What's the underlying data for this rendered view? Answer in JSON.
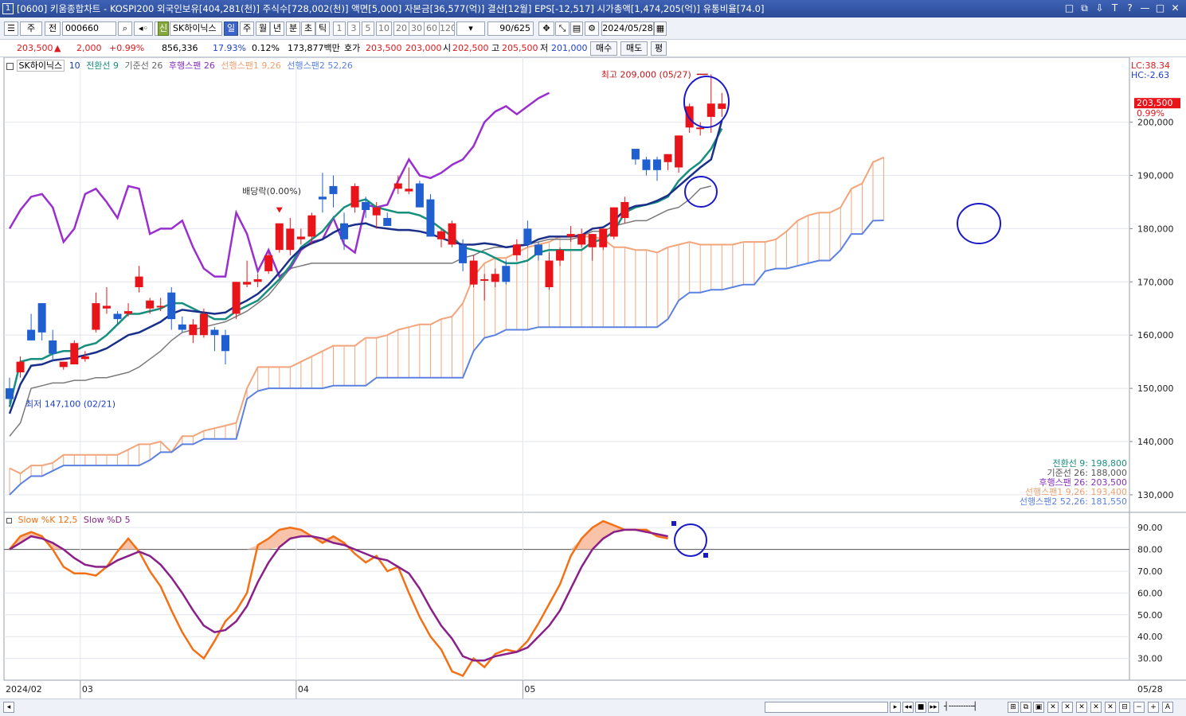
{
  "window": {
    "app_number": "1",
    "title": "[0600] 키움종합차트 - KOSPI200 외국인보유[404,281(천)] 주식수[728,002(천)] 액면[5,000] 자본금[36,577(억)] 결산[12월] EPS[-12,517] 시가총액[1,474,205(억)] 유통비율[74.0]",
    "controls": [
      "□",
      "⧉",
      "⇩",
      "T",
      "?",
      "—",
      "□",
      "✕"
    ]
  },
  "toolbar": {
    "period_select": "주",
    "all_label": "전",
    "code_input": "000660",
    "shin_badge": "신",
    "stock_name": "SK하이닉스",
    "periods": [
      "일",
      "주",
      "월",
      "년",
      "분",
      "초",
      "틱"
    ],
    "active_period": "일",
    "minute_options": [
      "1",
      "3",
      "5",
      "10",
      "20",
      "30",
      "60",
      "120"
    ],
    "count": "90/625",
    "date": "2024/05/28"
  },
  "quote": {
    "price": "203,500",
    "arrow": "▲",
    "change": "2,000",
    "change_pct": "+0.99%",
    "volume": "856,336",
    "turnover_pct": "17.93%",
    "vol_ratio": "0.12%",
    "amount": "173,877백만",
    "ask_label": "호가",
    "ask": "203,500",
    "bid": "203,000",
    "open_label": "시",
    "open": "202,500",
    "high_label": "고",
    "high": "205,500",
    "low_label": "저",
    "low": "201,000",
    "buy_btn": "매수",
    "sell_btn": "매도",
    "eval_btn": "평"
  },
  "legend_top": {
    "name": "SK하이닉스",
    "period": "10",
    "items": [
      {
        "text": "전환선 9",
        "color": "#1a8f80"
      },
      {
        "text": "기준선 26",
        "color": "#777777"
      },
      {
        "text": "후행스팬 26",
        "color": "#8a2fc0"
      },
      {
        "text": "선행스팬1 9,26",
        "color": "#f0a070"
      },
      {
        "text": "선행스팬2 52,26",
        "color": "#5b82e0"
      }
    ]
  },
  "legend_bottom": {
    "items": [
      {
        "text": "Slow %K 12,5",
        "color": "#f07010"
      },
      {
        "text": "Slow %D 5",
        "color": "#8a1f8a"
      }
    ]
  },
  "annotations": {
    "high": "최고 209,000 (05/27)",
    "low": "최저 147,100 (02/21)",
    "dividend": "배당락(0.00%)"
  },
  "right_axis": {
    "lc": "LC:38.34",
    "hc": "HC:-2.63",
    "price_tag": "203,500",
    "price_pct": "0.99%",
    "price_ticks": [
      "200,000",
      "190,000",
      "180,000",
      "170,000",
      "160,000",
      "150,000",
      "140,000",
      "130,000"
    ],
    "stoch_ticks": [
      "90.00",
      "80.00",
      "70.00",
      "60.00",
      "50.00",
      "40.00",
      "30.00"
    ],
    "values": [
      {
        "text": "전환선 9: 198,800",
        "color": "#1a8f80"
      },
      {
        "text": "기준선 26: 188,000",
        "color": "#555555"
      },
      {
        "text": "후행스팬 26: 203,500",
        "color": "#8a2fc0"
      },
      {
        "text": "선행스팬1 9,26: 193,400",
        "color": "#f0a070"
      },
      {
        "text": "선행스팬2 52,26: 181,550",
        "color": "#5b82e0"
      }
    ],
    "last_date": "05/28"
  },
  "x_axis": {
    "labels": [
      "2024/02",
      "03",
      "04",
      "05"
    ]
  },
  "chart_data": {
    "type": "candlestick",
    "price_range": [
      127000,
      211000
    ],
    "stoch_range": [
      20,
      97
    ],
    "stoch_reference": 80,
    "candles": [
      {
        "o": 150000,
        "h": 152000,
        "l": 147100,
        "c": 148000
      },
      {
        "o": 153000,
        "h": 156000,
        "l": 152000,
        "c": 155000
      },
      {
        "o": 161000,
        "h": 164000,
        "l": 159000,
        "c": 159000
      },
      {
        "o": 166000,
        "h": 166000,
        "l": 159000,
        "c": 160500
      },
      {
        "o": 159000,
        "h": 161000,
        "l": 155000,
        "c": 156500
      },
      {
        "o": 154000,
        "h": 155000,
        "l": 153500,
        "c": 155000
      },
      {
        "o": 154500,
        "h": 159000,
        "l": 154500,
        "c": 158500
      },
      {
        "o": 155500,
        "h": 157000,
        "l": 155000,
        "c": 156000
      },
      {
        "o": 161000,
        "h": 168000,
        "l": 160500,
        "c": 166000
      },
      {
        "o": 165000,
        "h": 169000,
        "l": 164000,
        "c": 165500
      },
      {
        "o": 164000,
        "h": 164500,
        "l": 162000,
        "c": 163000
      },
      {
        "o": 164000,
        "h": 166000,
        "l": 163500,
        "c": 164500
      },
      {
        "o": 169000,
        "h": 173000,
        "l": 168000,
        "c": 171000
      },
      {
        "o": 165000,
        "h": 167000,
        "l": 164000,
        "c": 166500
      },
      {
        "o": 165500,
        "h": 167000,
        "l": 164500,
        "c": 165500
      },
      {
        "o": 168000,
        "h": 169000,
        "l": 161000,
        "c": 163000
      },
      {
        "o": 162000,
        "h": 163500,
        "l": 160500,
        "c": 161000
      },
      {
        "o": 160000,
        "h": 163000,
        "l": 158500,
        "c": 162000
      },
      {
        "o": 160000,
        "h": 165000,
        "l": 159500,
        "c": 164000
      },
      {
        "o": 161000,
        "h": 161500,
        "l": 157000,
        "c": 160000
      },
      {
        "o": 160000,
        "h": 161000,
        "l": 154500,
        "c": 157000
      },
      {
        "o": 164000,
        "h": 170000,
        "l": 163000,
        "c": 170000
      },
      {
        "o": 169500,
        "h": 174000,
        "l": 169000,
        "c": 170000
      },
      {
        "o": 170000,
        "h": 171500,
        "l": 169000,
        "c": 170500
      },
      {
        "o": 172000,
        "h": 175500,
        "l": 171500,
        "c": 175000
      },
      {
        "o": 176000,
        "h": 181000,
        "l": 175500,
        "c": 181000
      },
      {
        "o": 176000,
        "h": 182000,
        "l": 175000,
        "c": 180000
      },
      {
        "o": 178000,
        "h": 180000,
        "l": 177000,
        "c": 178500
      },
      {
        "o": 178500,
        "h": 183000,
        "l": 177000,
        "c": 182500
      },
      {
        "o": 186000,
        "h": 190500,
        "l": 183000,
        "c": 185500
      },
      {
        "o": 188000,
        "h": 190000,
        "l": 184000,
        "c": 186500
      },
      {
        "o": 181000,
        "h": 183000,
        "l": 176000,
        "c": 178000
      },
      {
        "o": 184000,
        "h": 188500,
        "l": 183000,
        "c": 188000
      },
      {
        "o": 185000,
        "h": 186000,
        "l": 182000,
        "c": 183500
      },
      {
        "o": 182500,
        "h": 185000,
        "l": 180000,
        "c": 184000
      },
      {
        "o": 182000,
        "h": 183000,
        "l": 180500,
        "c": 180500
      },
      {
        "o": 187500,
        "h": 190000,
        "l": 186500,
        "c": 188500
      },
      {
        "o": 187000,
        "h": 191500,
        "l": 186500,
        "c": 187500
      },
      {
        "o": 188500,
        "h": 189000,
        "l": 184000,
        "c": 184000
      },
      {
        "o": 185500,
        "h": 186500,
        "l": 178500,
        "c": 178500
      },
      {
        "o": 178000,
        "h": 180000,
        "l": 176500,
        "c": 179500
      },
      {
        "o": 177000,
        "h": 181500,
        "l": 176500,
        "c": 181000
      },
      {
        "o": 177000,
        "h": 178000,
        "l": 172000,
        "c": 173500
      },
      {
        "o": 169500,
        "h": 175000,
        "l": 169000,
        "c": 174000
      },
      {
        "o": 170500,
        "h": 171500,
        "l": 166500,
        "c": 170500
      },
      {
        "o": 170000,
        "h": 172500,
        "l": 169000,
        "c": 171500
      },
      {
        "o": 173000,
        "h": 174000,
        "l": 169500,
        "c": 170000
      },
      {
        "o": 175000,
        "h": 178000,
        "l": 174000,
        "c": 177000
      },
      {
        "o": 180000,
        "h": 181500,
        "l": 176500,
        "c": 177000
      },
      {
        "o": 177000,
        "h": 177500,
        "l": 174000,
        "c": 175000
      },
      {
        "o": 169000,
        "h": 175500,
        "l": 168500,
        "c": 174000
      },
      {
        "o": 174000,
        "h": 176500,
        "l": 173000,
        "c": 176000
      },
      {
        "o": 178500,
        "h": 180500,
        "l": 177500,
        "c": 179000
      },
      {
        "o": 177000,
        "h": 180000,
        "l": 176500,
        "c": 179000
      },
      {
        "o": 176500,
        "h": 179000,
        "l": 174000,
        "c": 179000
      },
      {
        "o": 176500,
        "h": 180000,
        "l": 176000,
        "c": 180000
      },
      {
        "o": 178500,
        "h": 184000,
        "l": 178000,
        "c": 184000
      },
      {
        "o": 182000,
        "h": 186000,
        "l": 181000,
        "c": 185000
      },
      {
        "o": 195000,
        "h": 193000,
        "l": 192000,
        "c": 193000
      },
      {
        "o": 193000,
        "h": 193500,
        "l": 190000,
        "c": 191000
      },
      {
        "o": 193000,
        "h": 193500,
        "l": 189000,
        "c": 191000
      },
      {
        "o": 192500,
        "h": 194000,
        "l": 191000,
        "c": 194000
      },
      {
        "o": 191500,
        "h": 197500,
        "l": 190500,
        "c": 197500
      },
      {
        "o": 199000,
        "h": 203500,
        "l": 198000,
        "c": 203000
      },
      {
        "o": 199000,
        "h": 200000,
        "l": 197500,
        "c": 199000
      },
      {
        "o": 201000,
        "h": 209000,
        "l": 198000,
        "c": 203500
      },
      {
        "o": 202500,
        "h": 205500,
        "l": 201000,
        "c": 203500
      }
    ],
    "tenkan": [
      146500,
      155000,
      155500,
      155500,
      156500,
      157000,
      157000,
      158000,
      158500,
      160000,
      162000,
      164000,
      164000,
      164500,
      165000,
      166000,
      166000,
      165000,
      164000,
      163000,
      163000,
      164500,
      165500,
      166500,
      168500,
      170500,
      173000,
      176500,
      178000,
      179500,
      182000,
      184000,
      185000,
      185500,
      184000,
      183500,
      183000,
      183000,
      182500,
      181500,
      180000,
      178500,
      176500,
      176000,
      175500,
      174500,
      173500,
      173500,
      174000,
      175500,
      176000,
      176000,
      176000,
      176000,
      177500,
      178000,
      179500,
      183000,
      184000,
      184500,
      185000,
      186000,
      189000,
      191000,
      192500,
      195000,
      198800
    ],
    "kijun": [
      141000,
      143500,
      150000,
      150500,
      151000,
      151000,
      151500,
      151500,
      152000,
      152000,
      152500,
      153000,
      154000,
      155500,
      157000,
      159000,
      160500,
      161000,
      161500,
      162000,
      162500,
      163500,
      164500,
      166000,
      167500,
      170000,
      172500,
      173000,
      173500,
      173500,
      173500,
      173500,
      173500,
      173500,
      173500,
      173500,
      173500,
      173500,
      173500,
      173500,
      173500,
      173500,
      174500,
      175000,
      176000,
      176500,
      176500,
      177000,
      177000,
      177500,
      178000,
      178000,
      178000,
      178500,
      179500,
      179500,
      180500,
      181000,
      181500,
      181500,
      182500,
      183500,
      184000,
      185500,
      187500,
      188000
    ],
    "chikou": [
      180000,
      183500,
      186000,
      186500,
      184000,
      177500,
      180000,
      186500,
      187500,
      185000,
      182000,
      188000,
      187500,
      179000,
      180000,
      180000,
      181500,
      176500,
      172500,
      171000,
      171000,
      183000,
      179000,
      172000,
      176000,
      171000,
      172500,
      176000,
      177500,
      178000,
      182000,
      177000,
      175500,
      184500,
      184000,
      184500,
      189000,
      193000,
      190000,
      189500,
      190500,
      192000,
      193000,
      195500,
      200000,
      202000,
      203000,
      201500,
      203000,
      204500,
      205500
    ],
    "span_a": [
      135000,
      134000,
      135500,
      135500,
      136000,
      137500,
      137500,
      137500,
      137500,
      137500,
      137500,
      138500,
      139500,
      139500,
      140000,
      138000,
      141000,
      141000,
      142000,
      142500,
      143000,
      143500,
      150000,
      154000,
      154000,
      154000,
      154000,
      155000,
      156000,
      157000,
      158000,
      158000,
      158000,
      159500,
      159500,
      160000,
      161000,
      161500,
      162000,
      162000,
      163000,
      163500,
      166000,
      171000,
      173500,
      174500,
      174500,
      175500,
      176500,
      177000,
      177500,
      178500,
      178500,
      178500,
      178500,
      178000,
      176500,
      176500,
      176000,
      176000,
      175500,
      176500,
      177000,
      177500,
      177000,
      177000,
      177000,
      177000,
      177500,
      177500,
      177500,
      178000,
      179500,
      181500,
      182500,
      183000,
      183000,
      184000,
      187500,
      188500,
      192500,
      193400
    ],
    "span_b": [
      130000,
      132000,
      133500,
      133500,
      134500,
      135500,
      135500,
      135500,
      135500,
      135500,
      135500,
      135500,
      135500,
      136500,
      138000,
      138000,
      139500,
      139500,
      140500,
      140500,
      140500,
      140500,
      148000,
      149500,
      150000,
      150000,
      150000,
      150000,
      150000,
      150000,
      150500,
      150500,
      150500,
      150500,
      152000,
      152000,
      152000,
      152000,
      152000,
      152000,
      152000,
      152000,
      152000,
      157000,
      159500,
      160000,
      161000,
      161000,
      161000,
      161500,
      161500,
      161500,
      161500,
      161500,
      161500,
      161500,
      161500,
      161500,
      161500,
      161500,
      161500,
      163000,
      166500,
      168000,
      168000,
      168500,
      168500,
      169000,
      169500,
      169500,
      172000,
      172500,
      172500,
      173000,
      173500,
      174000,
      174000,
      176000,
      179000,
      179000,
      181500,
      181550
    ],
    "slow_k": [
      80,
      86,
      88,
      86,
      80,
      72,
      69,
      69,
      68,
      72,
      79,
      85,
      79,
      70,
      63,
      52,
      42,
      34,
      30,
      38,
      47,
      52,
      60,
      82,
      85,
      89,
      90,
      89,
      86,
      83,
      86,
      83,
      78,
      74,
      77,
      70,
      72,
      60,
      49,
      40,
      34,
      24,
      22,
      30,
      26,
      32,
      34,
      33,
      38,
      46,
      55,
      64,
      77,
      85,
      90,
      93,
      91,
      89,
      89,
      89,
      86,
      85
    ],
    "slow_d": [
      80,
      83,
      86,
      85,
      83,
      80,
      76,
      73,
      72,
      72,
      75,
      77,
      79,
      77,
      73,
      67,
      60,
      52,
      45,
      42,
      43,
      47,
      54,
      65,
      74,
      81,
      85,
      86,
      86,
      85,
      83,
      82,
      80,
      78,
      76,
      75,
      72,
      69,
      62,
      53,
      45,
      39,
      31,
      29,
      29,
      31,
      32,
      33,
      35,
      40,
      45,
      52,
      62,
      72,
      80,
      85,
      88,
      89,
      89,
      88,
      87,
      86
    ]
  }
}
